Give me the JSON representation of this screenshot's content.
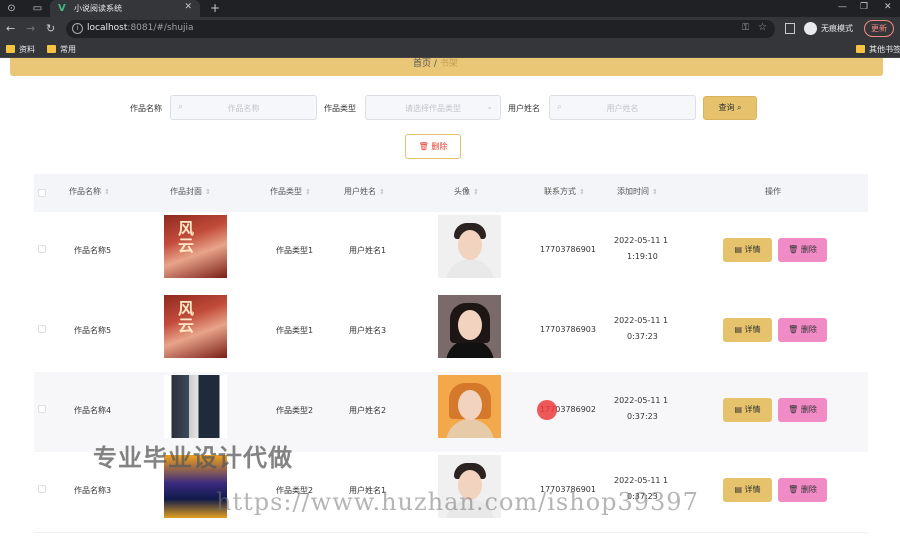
{
  "browser": {
    "tab_title": "小说阅读系统",
    "url_host": "localhost",
    "url_rest": ":8081/#/shujia",
    "incognito_label": "无痕模式",
    "update_label": "更新",
    "bookmarks": [
      "资料",
      "常用"
    ],
    "bookmark_right": "其他书签"
  },
  "breadcrumb": {
    "home": "首页",
    "sep": "/",
    "current": "书架"
  },
  "search": {
    "work_name_label": "作品名称",
    "work_name_placeholder": "作品名称",
    "work_type_label": "作品类型",
    "work_type_placeholder": "请选择作品类型",
    "user_name_label": "用户姓名",
    "user_name_placeholder": "用户姓名",
    "query_button": "查询",
    "batch_delete_button": "删除"
  },
  "table": {
    "headers": [
      "作品名称",
      "作品封面",
      "作品类型",
      "用户姓名",
      "头像",
      "联系方式",
      "添加时间",
      "操作"
    ],
    "detail_button": "详情",
    "delete_button": "删除",
    "rows": [
      {
        "name": "作品名称5",
        "type": "作品类型1",
        "user": "用户姓名1",
        "phone": "17703786901",
        "time_line1": "2022-05-11 1",
        "time_line2": "1:19:10",
        "cover": "pink",
        "avatar": "boy"
      },
      {
        "name": "作品名称5",
        "type": "作品类型1",
        "user": "用户姓名3",
        "phone": "17703786903",
        "time_line1": "2022-05-11 1",
        "time_line2": "0:37:23",
        "cover": "pink",
        "avatar": "girl"
      },
      {
        "name": "作品名称4",
        "type": "作品类型2",
        "user": "用户姓名2",
        "phone": "17703786902",
        "time_line1": "2022-05-11 1",
        "time_line2": "0:37:23",
        "cover": "books",
        "avatar": "ginger"
      },
      {
        "name": "作品名称3",
        "type": "作品类型2",
        "user": "用户姓名1",
        "phone": "17703786901",
        "time_line1": "2022-05-11 1",
        "time_line2": "0:37:23",
        "cover": "fantasy",
        "avatar": "boy"
      }
    ]
  },
  "cover_text": "风云",
  "watermark": {
    "line1": "专业毕业设计代做",
    "line2": "https://www.huzhan.com/ishop39397"
  }
}
